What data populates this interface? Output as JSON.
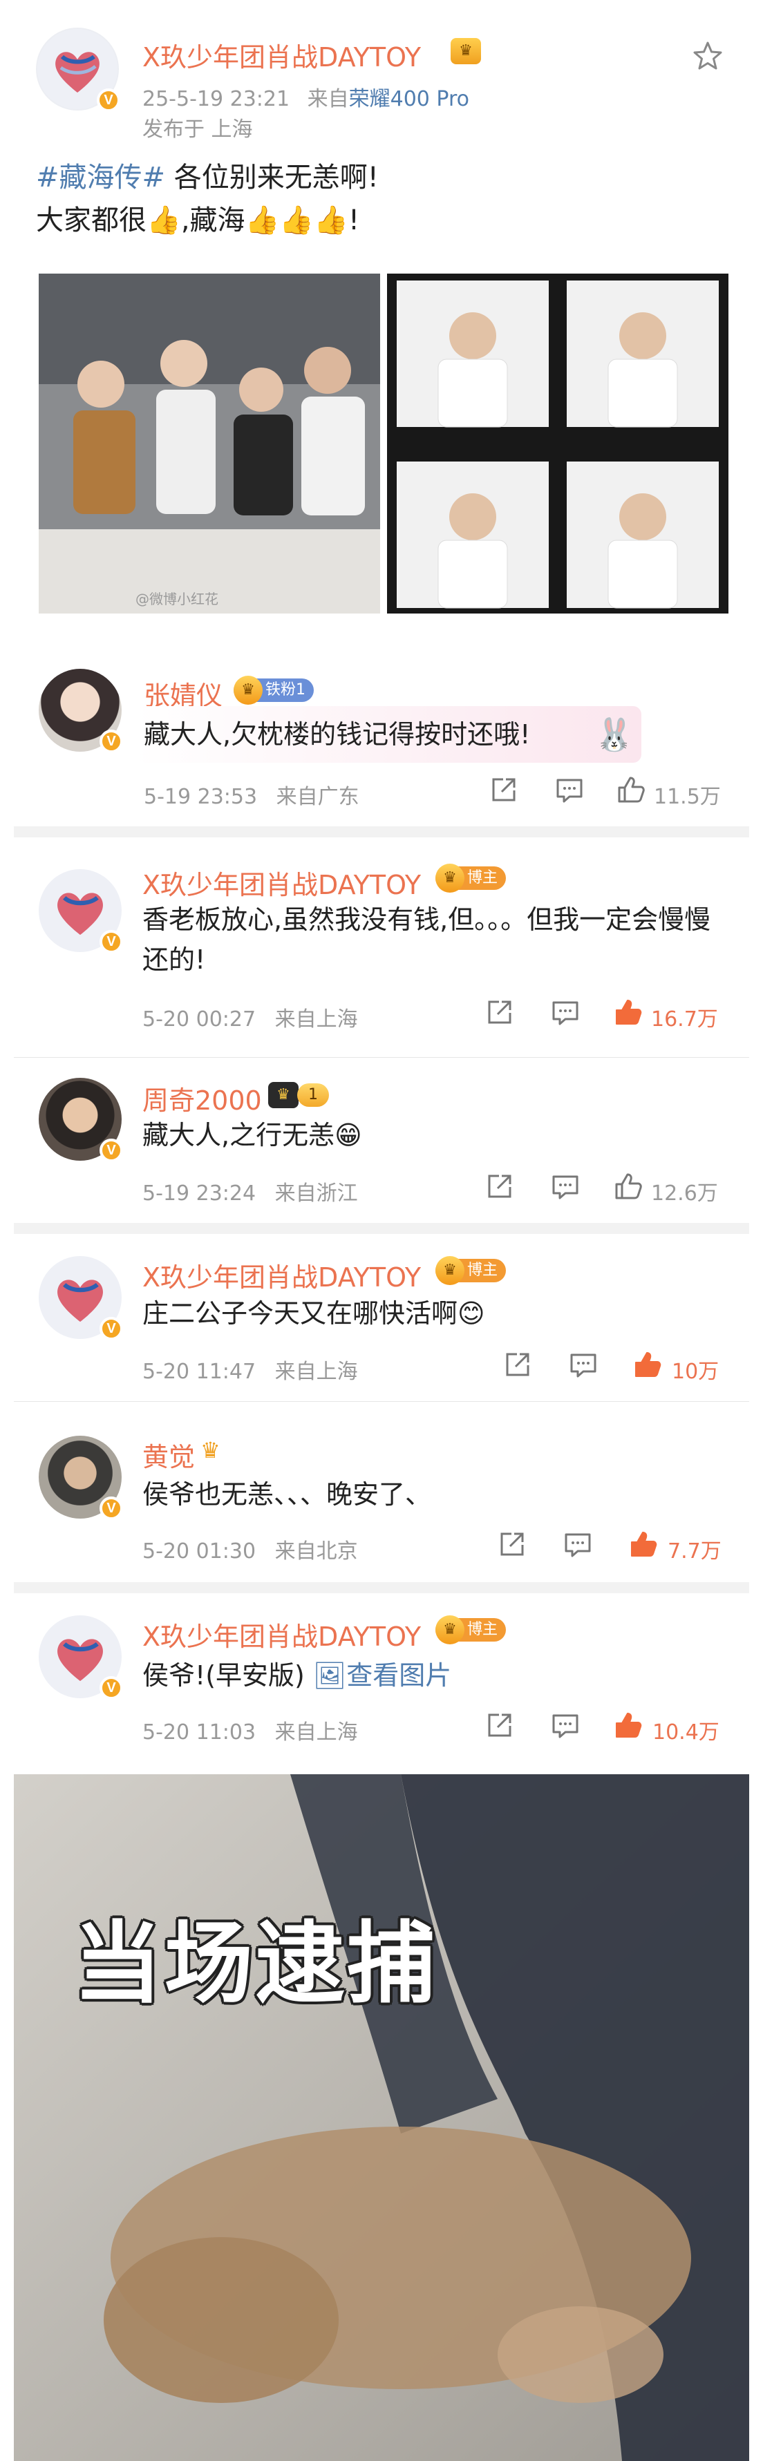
{
  "post": {
    "author": "X玖少年团肖战DAYTOY",
    "datetime": "25-5-19 23:21",
    "source_prefix": "来自",
    "device": "荣耀400 Pro",
    "location": "发布于 上海",
    "hashtag": "#藏海传#",
    "line1_rest": "各位别来无恙啊!",
    "line2_a": "大家都很",
    "line2_b": ",藏海",
    "line2_end": "!",
    "photo_watermark": "@微博小红花"
  },
  "comments": [
    {
      "user": "张婧仪",
      "badge": "铁粉1",
      "text": "藏大人,欠枕楼的钱记得按时还哦!",
      "time": "5-19 23:53",
      "region": "来自广东",
      "likes": "11.5万",
      "liked": false
    },
    {
      "user": "X玖少年团肖战DAYTOY",
      "badge": "博主",
      "text": "香老板放心,虽然我没有钱,但。。。但我一定会慢慢还的!",
      "time": "5-20 00:27",
      "region": "来自上海",
      "likes": "16.7万",
      "liked": true
    },
    {
      "user": "周奇2000",
      "badge": "1",
      "text": "藏大人,之行无恙",
      "time": "5-19 23:24",
      "region": "来自浙江",
      "likes": "12.6万",
      "liked": false
    },
    {
      "user": "X玖少年团肖战DAYTOY",
      "badge": "博主",
      "text": "庄二公子今天又在哪快活啊",
      "time": "5-20 11:47",
      "region": "来自上海",
      "likes": "10万",
      "liked": true
    },
    {
      "user": "黄觉",
      "badge": "",
      "text": "侯爷也无恙、、、晚安了、",
      "time": "5-20 01:30",
      "region": "来自北京",
      "likes": "7.7万",
      "liked": true
    },
    {
      "user": "X玖少年团肖战DAYTOY",
      "badge": "博主",
      "text": "侯爷!(早安版)",
      "link": "查看图片",
      "time": "5-20 11:03",
      "region": "来自上海",
      "likes": "10.4万",
      "liked": true
    }
  ],
  "meme": {
    "caption": "当场逮捕"
  },
  "colors": {
    "accent": "#eb7350",
    "link": "#507daf",
    "meta": "#999999"
  }
}
